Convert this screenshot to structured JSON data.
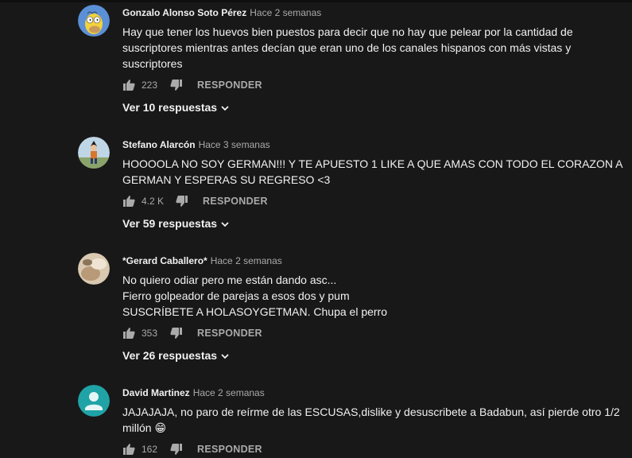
{
  "comments": [
    {
      "author": "Gonzalo Alonso Soto Pérez",
      "time": "Hace 2 semanas",
      "lines": [
        "Hay que tener los huevos bien puestos para decir que no hay que pelear por la cantidad de",
        "suscriptores mientras antes decían que eran uno de los canales hispanos con más vistas y",
        "suscriptores"
      ],
      "likes": "223",
      "reply_label": "RESPONDER",
      "replies_label": "Ver 10 respuestas",
      "avatar_icon": "homer-avatar"
    },
    {
      "author": "Stefano Alarcón",
      "time": "Hace 3 semanas",
      "lines": [
        "HOOOOLA NO SOY GERMAN!!! Y TE APUESTO 1 LIKE A QUE AMAS CON TODO EL CORAZON A",
        "GERMAN Y ESPERAS SU REGRESO <3"
      ],
      "likes": "4.2 K",
      "reply_label": "RESPONDER",
      "replies_label": "Ver 59 respuestas",
      "avatar_icon": "dragonball-avatar"
    },
    {
      "author": "*Gerard Caballero*",
      "time": "Hace 2 semanas",
      "lines": [
        "No quiero odiar pero me están dando asc...",
        "Fierro golpeador de parejas a esos dos y pum",
        "SUSCRÍBETE A HOLASOYGETMAN. Chupa el perro"
      ],
      "likes": "353",
      "reply_label": "RESPONDER",
      "replies_label": "Ver 26 respuestas",
      "avatar_icon": "photo-avatar"
    },
    {
      "author": "David Martinez",
      "time": "Hace 2 semanas",
      "lines": [
        "JAJAJAJA, no paro de reírme de las ESCUSAS,dislike y desuscribete a Badabun, así pierde otro 1/2",
        "millón 😁"
      ],
      "likes": "162",
      "reply_label": "RESPONDER",
      "replies_label": "",
      "avatar_icon": "default-user-avatar"
    }
  ],
  "colors": {
    "background": "#181818",
    "text": "#f1f1f1",
    "secondary": "#aaaaaa",
    "default_avatar": "#1fa3a6"
  }
}
